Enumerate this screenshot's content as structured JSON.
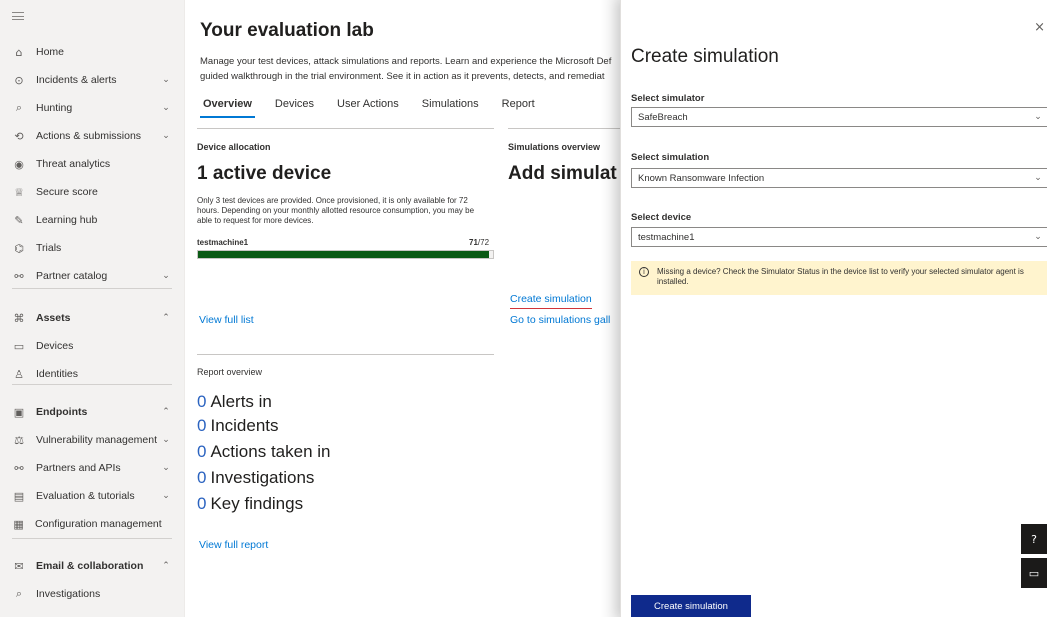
{
  "sidebar": {
    "items": [
      {
        "label": "Home",
        "icon": "home-icon",
        "glyph": "⌂",
        "chev": ""
      },
      {
        "label": "Incidents & alerts",
        "icon": "shield-alert-icon",
        "glyph": "⊙",
        "chev": "⌄"
      },
      {
        "label": "Hunting",
        "icon": "hunting-icon",
        "glyph": "⌕",
        "chev": "⌄"
      },
      {
        "label": "Actions & submissions",
        "icon": "actions-icon",
        "glyph": "⟲",
        "chev": "⌄"
      },
      {
        "label": "Threat analytics",
        "icon": "threat-analytics-icon",
        "glyph": "◉",
        "chev": ""
      },
      {
        "label": "Secure score",
        "icon": "trophy-icon",
        "glyph": "♕",
        "chev": ""
      },
      {
        "label": "Learning hub",
        "icon": "learning-icon",
        "glyph": "✎",
        "chev": ""
      },
      {
        "label": "Trials",
        "icon": "gift-icon",
        "glyph": "⌬",
        "chev": ""
      },
      {
        "label": "Partner catalog",
        "icon": "partner-icon",
        "glyph": "⚯",
        "chev": "⌄"
      },
      {
        "label": "Assets",
        "icon": "assets-icon",
        "glyph": "⌘",
        "chev": "⌃",
        "bold": true
      },
      {
        "label": "Devices",
        "icon": "devices-icon",
        "glyph": "▭",
        "chev": ""
      },
      {
        "label": "Identities",
        "icon": "person-icon",
        "glyph": "♙",
        "chev": ""
      },
      {
        "label": "Endpoints",
        "icon": "endpoints-icon",
        "glyph": "▣",
        "chev": "⌃",
        "bold": true
      },
      {
        "label": "Vulnerability management",
        "icon": "vulnerability-icon",
        "glyph": "⚖",
        "chev": "⌄"
      },
      {
        "label": "Partners and APIs",
        "icon": "partners-api-icon",
        "glyph": "⚯",
        "chev": "⌄"
      },
      {
        "label": "Evaluation & tutorials",
        "icon": "evaluation-icon",
        "glyph": "▤",
        "chev": "⌄"
      },
      {
        "label": "Configuration management",
        "icon": "config-icon",
        "glyph": "▦",
        "chev": ""
      },
      {
        "label": "Email & collaboration",
        "icon": "mail-icon",
        "glyph": "✉",
        "chev": "⌃",
        "bold": true
      },
      {
        "label": "Investigations",
        "icon": "investigations-icon",
        "glyph": "⌕",
        "chev": ""
      }
    ]
  },
  "main": {
    "title": "Your evaluation lab",
    "description_line1": "Manage your test devices, attack simulations and reports. Learn and experience the Microsoft Def",
    "description_line2": "guided walkthrough in the trial environment. See it in action as it prevents, detects, and remediat",
    "tabs": [
      "Overview",
      "Devices",
      "User Actions",
      "Simulations",
      "Report"
    ],
    "device_allocation": {
      "label": "Device allocation",
      "heading": "1 active device",
      "note_line1": "Only 3 test devices are provided. Once provisioned, it is only available for 72",
      "note_line2": "hours. Depending on your monthly allotted resource consumption, you may be",
      "note_line3": "able to request for more devices.",
      "device_name": "testmachine1",
      "hours_used": "71",
      "hours_total": "/72",
      "progress_fraction": 0.986,
      "link": "View full list"
    },
    "simulations_overview": {
      "label": "Simulations overview",
      "heading": "Add simulat",
      "link1": "Create simulation",
      "link2": "Go to simulations gall"
    },
    "report_overview": {
      "label": "Report overview",
      "lines": [
        {
          "num": "0",
          "text": "Alerts in"
        },
        {
          "num": "0",
          "text": "Incidents"
        },
        {
          "num": "0",
          "text": "Actions taken in"
        },
        {
          "num": "0",
          "text": "Investigations"
        },
        {
          "num": "0",
          "text": "Key findings"
        }
      ],
      "link": "View full report"
    }
  },
  "panel": {
    "title": "Create simulation",
    "close": "×",
    "simulator_label": "Select simulator",
    "simulator_value": "SafeBreach",
    "simulation_label": "Select simulation",
    "simulation_value": "Known Ransomware Infection",
    "device_label": "Select device",
    "device_value": "testmachine1",
    "warning_line1": "Missing a device? Check the Simulator Status in the device list to verify your selected simulator agent is",
    "warning_line2": "installed.",
    "primary_button": "Create simulation"
  },
  "colors": {
    "accent": "#0078d4",
    "progress": "#0b5a15",
    "warning_bg": "#fff4ce",
    "primary_button": "#0f2a8c"
  }
}
